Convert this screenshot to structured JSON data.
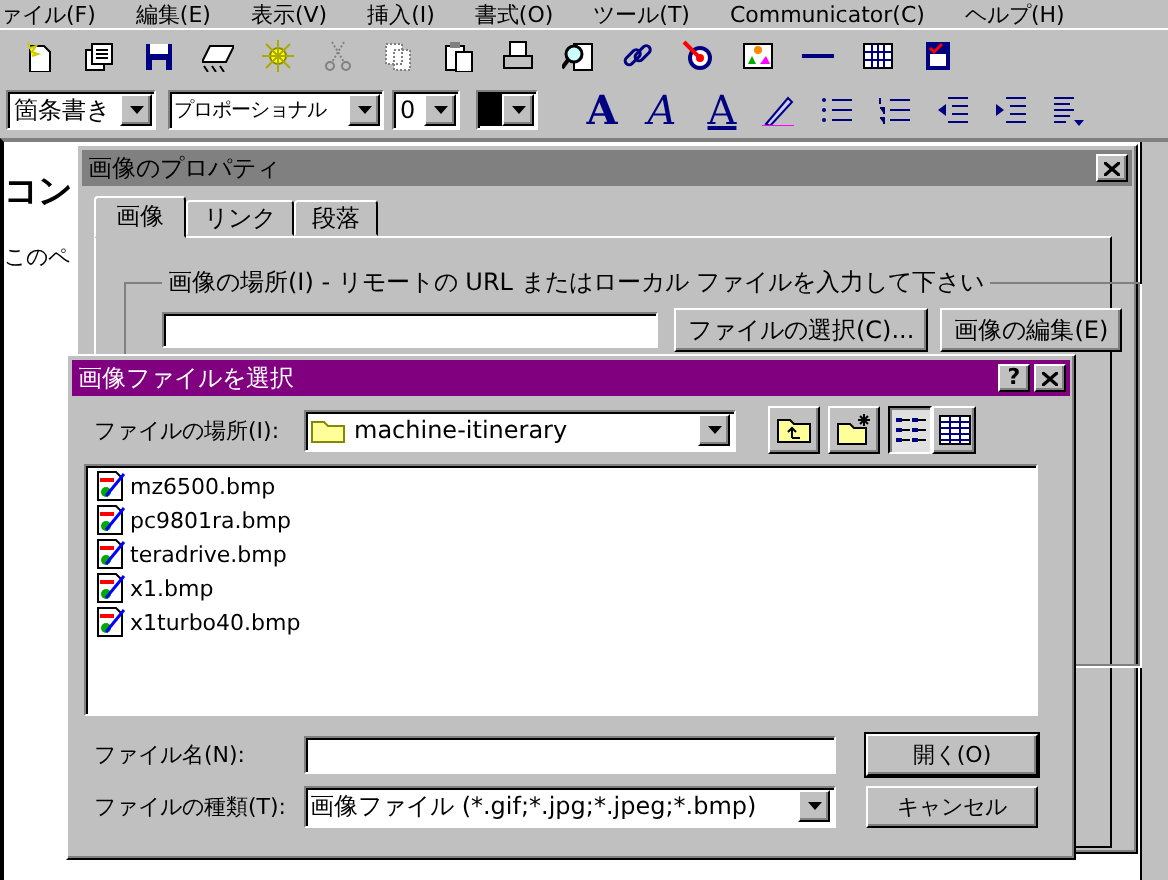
{
  "menu": [
    "ァイル(F)",
    "編集(E)",
    "表示(V)",
    "挿入(I)",
    "書式(O)",
    "ツール(T)",
    "Communicator(C)",
    "ヘルプ(H)"
  ],
  "format_bar": {
    "paragraph_style": "箇条書き",
    "font": "プロポーショナル",
    "size": "0",
    "color": "#000000",
    "format_buttons": [
      {
        "kind": "bold",
        "label": "A"
      },
      {
        "kind": "italic",
        "label": "A"
      },
      {
        "kind": "underline",
        "label": "A"
      }
    ]
  },
  "document": {
    "heading": "コン",
    "text": "このペ"
  },
  "properties_dialog": {
    "title": "画像のプロパティ",
    "tabs": [
      {
        "label": "画像",
        "selected": true
      },
      {
        "label": "リンク",
        "selected": false
      },
      {
        "label": "段落",
        "selected": false
      }
    ],
    "group_label": "画像の場所(I) - リモートの URL またはローカル ファイルを入力して下さい",
    "buttons": [
      "ファイルの選択(C)...",
      "画像の編集(E)"
    ]
  },
  "file_dialog": {
    "title": "画像ファイルを選択",
    "help_button": "?",
    "location_label": "ファイルの場所(I):",
    "folder": "machine-itinerary",
    "view_buttons": [
      {
        "kind": "list",
        "selected": true
      },
      {
        "kind": "details",
        "selected": false
      }
    ],
    "files": [
      {
        "name": "mz6500.bmp"
      },
      {
        "name": "pc9801ra.bmp"
      },
      {
        "name": "teradrive.bmp"
      },
      {
        "name": "x1.bmp"
      },
      {
        "name": "x1turbo40.bmp"
      }
    ],
    "filename_label": "ファイル名(N):",
    "filetype_label": "ファイルの種類(T):",
    "filetype": "画像ファイル (*.gif;*.jpg;*.jpeg;*.bmp)",
    "buttons": [
      {
        "label": "開く(O)",
        "default": true
      },
      {
        "label": "キャンセル",
        "default": false
      }
    ]
  }
}
